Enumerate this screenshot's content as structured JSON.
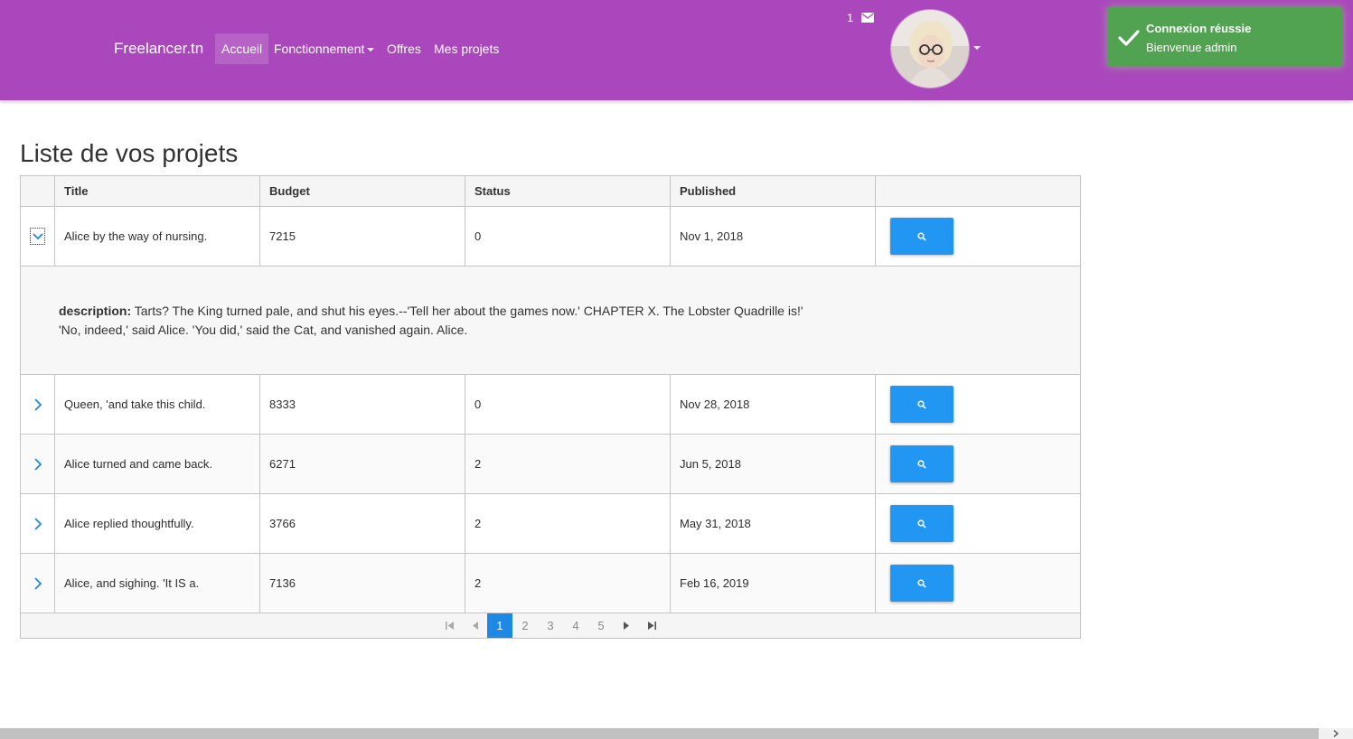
{
  "navbar": {
    "brand": "Freelancer.tn",
    "links": [
      "Accueil",
      "Fonctionnement",
      "Offres",
      "Mes projets"
    ],
    "message_count": "1",
    "accent_color": "#ab47bc"
  },
  "toast": {
    "title": "Connexion réussie",
    "message": "Bienvenue admin",
    "color": "#51a351"
  },
  "page": {
    "title": "Liste de vos projets"
  },
  "table": {
    "columns": [
      "Title",
      "Budget",
      "Status",
      "Published"
    ],
    "rows": [
      {
        "title": "Alice by the way of nursing.",
        "budget": "7215",
        "status": "0",
        "published": "Nov 1, 2018"
      },
      {
        "title": "Queen, 'and take this child.",
        "budget": "8333",
        "status": "0",
        "published": "Nov 28, 2018"
      },
      {
        "title": "Alice turned and came back.",
        "budget": "6271",
        "status": "2",
        "published": "Jun 5, 2018"
      },
      {
        "title": "Alice replied thoughtfully.",
        "budget": "3766",
        "status": "2",
        "published": "May 31, 2018"
      },
      {
        "title": "Alice, and sighing. 'It IS a.",
        "budget": "7136",
        "status": "2",
        "published": "Feb 16, 2019"
      }
    ],
    "detail": {
      "label": "description:",
      "line1": " Tarts? The King turned pale, and shut his eyes.--'Tell her about the games now.' CHAPTER X. The Lobster Quadrille is!'",
      "line2": "'No, indeed,' said Alice. 'You did,' said the Cat, and vanished again. Alice."
    },
    "button_color": "#2196f3"
  },
  "pager": {
    "pages": [
      "1",
      "2",
      "3",
      "4",
      "5"
    ],
    "current": "1"
  }
}
